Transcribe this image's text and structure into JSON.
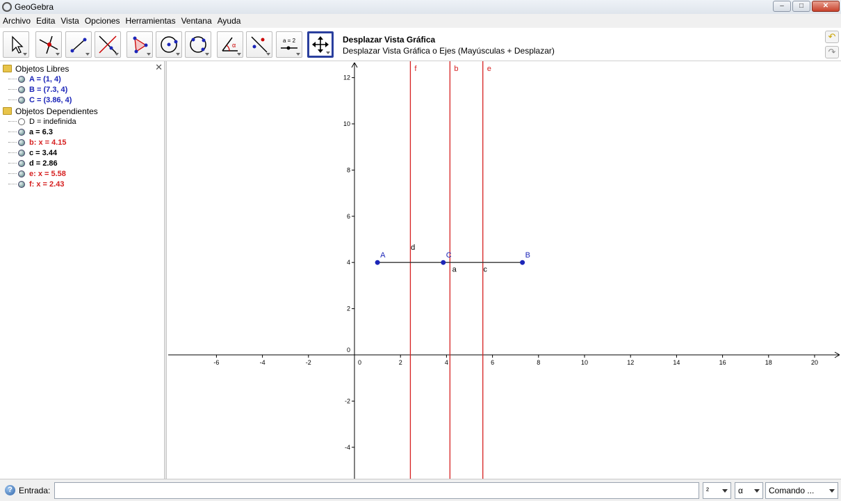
{
  "window": {
    "title": "GeoGebra",
    "buttons": {
      "minimize": "–",
      "maximize": "□",
      "close": "✕"
    }
  },
  "menu": [
    "Archivo",
    "Edita",
    "Vista",
    "Opciones",
    "Herramientas",
    "Ventana",
    "Ayuda"
  ],
  "toolbar": {
    "tools": [
      {
        "icon": "pointer-icon"
      },
      {
        "icon": "point-intersect-icon"
      },
      {
        "icon": "line-icon"
      },
      {
        "icon": "perpendicular-line-icon"
      },
      {
        "icon": "polygon-icon"
      },
      {
        "icon": "circle-center-point-icon"
      },
      {
        "icon": "circle-three-points-icon"
      },
      {
        "icon": "angle-icon"
      },
      {
        "icon": "reflect-icon"
      },
      {
        "icon": "slider-icon",
        "label": "a = 2"
      },
      {
        "icon": "move-graphics-view-icon",
        "selected": true
      }
    ],
    "active_tool_name": "Desplazar Vista Gráfica",
    "active_tool_help": "Desplazar Vista Gráfica o Ejes (Mayúsculas + Desplazar)",
    "undo_icon": "undo-icon",
    "redo_icon": "redo-icon"
  },
  "algebra": {
    "free_label": "Objetos Libres",
    "free": [
      {
        "text": "A = (1, 4)",
        "color": "blue"
      },
      {
        "text": "B = (7.3, 4)",
        "color": "blue"
      },
      {
        "text": "C = (3.86, 4)",
        "color": "blue"
      }
    ],
    "dependent_label": "Objetos Dependientes",
    "dependent": [
      {
        "text": "D = indefinida",
        "color": "black",
        "hidden": true
      },
      {
        "text": "a = 6.3",
        "color": "black"
      },
      {
        "text": "b: x = 4.15",
        "color": "red"
      },
      {
        "text": "c = 3.44",
        "color": "black"
      },
      {
        "text": "d = 2.86",
        "color": "black"
      },
      {
        "text": "e: x = 5.58",
        "color": "red"
      },
      {
        "text": "f: x = 2.43",
        "color": "red"
      }
    ]
  },
  "graphics": {
    "x_ticks": [
      -6,
      -4,
      -2,
      0,
      2,
      4,
      6,
      8,
      10,
      12,
      14,
      16,
      18,
      20
    ],
    "y_ticks": [
      -4,
      -2,
      0,
      2,
      4,
      6,
      8,
      10,
      12
    ],
    "vertical_lines": [
      {
        "name": "f",
        "x": 2.43
      },
      {
        "name": "b",
        "x": 4.15
      },
      {
        "name": "e",
        "x": 5.58
      }
    ],
    "points": [
      {
        "name": "A",
        "x": 1,
        "y": 4
      },
      {
        "name": "C",
        "x": 3.86,
        "y": 4
      },
      {
        "name": "B",
        "x": 7.3,
        "y": 4
      }
    ],
    "segment_labels": [
      {
        "name": "a",
        "x": 4.25,
        "y": 3.6
      },
      {
        "name": "c",
        "x": 5.6,
        "y": 3.6
      },
      {
        "name": "d",
        "x": 2.45,
        "y": 4.55
      }
    ],
    "colors": {
      "line": "#d62020",
      "point": "#1c26b8",
      "segment": "#333333"
    }
  },
  "inputbar": {
    "label": "Entrada:",
    "value": "",
    "combo_power": "²",
    "combo_greek": "α",
    "combo_command": "Comando ..."
  }
}
